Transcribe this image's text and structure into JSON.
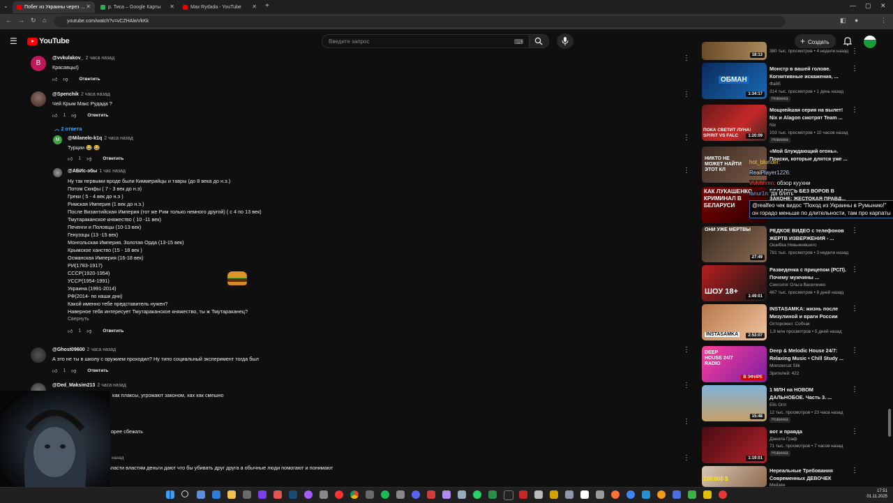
{
  "browser": {
    "tabs": [
      {
        "title": "Побег из Украины через ..."
      },
      {
        "title": "р. Тиса – Google Карты"
      },
      {
        "title": "Max Rydada - YouTube"
      }
    ],
    "url": "youtube.com/watch?v=vCZHAlwVkKk"
  },
  "youtube": {
    "logo": "YouTube",
    "search_placeholder": "Введите запрос",
    "create_label": "Создать"
  },
  "comments": [
    {
      "author": "@vvkulakov_",
      "time": "2 часа назад",
      "text": "Красавцы!)",
      "likes": "",
      "reply": "Ответить",
      "avatar_letter": "В"
    },
    {
      "author": "@Spenchik",
      "time": "2 часа назад",
      "text": "Чей Крым Макс Рудада ?",
      "likes": "1",
      "reply": "Ответить",
      "replies_toggle": "2 ответа"
    },
    {
      "author": "@Milanelo-k1q",
      "time": "2 часа назад",
      "text": "Турции 😂 😂",
      "likes": "1",
      "reply": "Ответить",
      "avatar_letter": "M"
    },
    {
      "author": "@АБИс-эбы",
      "time": "1 час назад",
      "lines": [
        "Ну так первыми вроде были Киммерийцы и тавры (до 8 века до н.э.)",
        "Потом Скифы ( 7 - 3 век до н.э)",
        "Греки ( 5 - 4 век до н.э )",
        "Римская Империя (1 век до н.э.)",
        "После Византийская Империя (тот же Рим только немного другой) ( с 4 по 13 век)",
        "Тмутараканское княжество ( 10 -11 век)",
        "Печенги и Половцы (10-13 век)",
        "Генуэзцы (13 -15 век)",
        "Монгольская Империя, Золотая Орда (13-15 век)",
        "Крымское ханство (15 - 18 век )",
        "Османская Империя (16-18 век)",
        "РИ(1783-1917)",
        "СССР(1920-1954)",
        "УССР(1954-1991)",
        "Украина (1991-2014)",
        "РФ(2014- по наши дни)",
        "Какой именно тебе представитель нужен?",
        "Наверное тебя интересует Тмутараканское княжество, ты ж Тмутараканец?"
      ],
      "collapse": "Свернуть",
      "likes": "1",
      "reply": "Ответить"
    },
    {
      "author": "@Ghost09600",
      "time": "2 часа назад",
      "text": "А это не ты в школу с оружием проходил? Ну типо социальный эксперимент тогда был",
      "likes": "1",
      "reply": "Ответить"
    },
    {
      "author": "@Ded_Maksim213",
      "time": "2 часа назад",
      "text": "как плаксы, угрожают законом, хах как смешно"
    },
    {
      "text": "орее сбежать"
    },
    {
      "time": "назад",
      "text": "власти властям деньги дают что бы убивать друг друга а обычные люди помогают и понимают"
    }
  ],
  "sidebar": [
    {
      "duration": "18:13",
      "meta1": "380 тыс. просмотров • 4 недели назад",
      "thumb_text": ""
    },
    {
      "title": "Монстр в вашей голове. Когнитивные искажения, ...",
      "channel": "Файб",
      "meta": "314 тыс. просмотров • 1 день назад",
      "badge": "Новинка",
      "duration": "1:34:17",
      "thumb_text": "ОБМАН"
    },
    {
      "title": "Мощнейшая серия на вылет! Nix и Alagon смотрят Team ...",
      "channel": "Nix",
      "meta": "103 тыс. просмотров • 10 часов назад",
      "badge": "Новинка",
      "duration": "1:20:09",
      "thumb_text": "ПОКА СВЕТИТ ЛУНА! SPIRIT VS FALC"
    },
    {
      "title": "«Мой блуждающий огонь». Поиски, которые длятся уже ...",
      "channel": "",
      "meta": "",
      "duration": "",
      "thumb_text": "НИКТО НЕ МОЖЕТ НАЙТИ ЭТОТ КЛ"
    },
    {
      "title": "БЕЛАРУСЬ БЕЗ ВОРОВ В ЗАКОНЕ: ЖЕСТОКАЯ ПРАВД...",
      "channel": "",
      "meta": "",
      "duration": "",
      "thumb_text": "КАК ЛУКАШЕНКО КРИМИНАЛ В БЕЛАРУСИ"
    },
    {
      "title": "РЕДКОЕ ВИДЕО с телефонов ЖЕРТВ ИЗВЕРЖЕНИЯ - ...",
      "channel": "Ошибка Невыжившего",
      "meta": "781 тыс. просмотров • 3 недели назад",
      "duration": "27:49",
      "thumb_text": "ОНИ УЖЕ МЕРТВЫ"
    },
    {
      "title": "Разведенка с прицепом (РСП). Почему мужчины ...",
      "channel": "Сексолог Ольга Василенко",
      "meta": "467 тыс. просмотров • 8 дней назад",
      "duration": "1:49:01",
      "thumb_text": "ШОУ 18+"
    },
    {
      "title": "INSTASAMKA: жизнь после Мизулиной и враги России",
      "channel": "Осторожно: Собчак",
      "meta": "1,8 млн просмотров • 5 дней назад",
      "duration": "2:53:07",
      "thumb_text": "INSTASAMKA"
    },
    {
      "title": "Deep & Melodic House 24/7: Relaxing Music • Chill Study ...",
      "channel": "Monstercat Silk",
      "meta": "Зрителей: 422",
      "duration": "",
      "live": "В ЭФИРЕ",
      "thumb_text": "DEEP HOUSE 24/7 RADIO"
    },
    {
      "title": "1 МЛН на НОВОМ ДАЛЬНОБОЕ. Часть 3. ...",
      "channel": "Elis Grin",
      "meta": "12 тыс. просмотров • 23 часа назад",
      "badge": "Новинка",
      "duration": "15:48",
      "thumb_text": ""
    },
    {
      "title": "вот и правда",
      "channel": "Данила Граф",
      "meta": "71 тыс. просмотров • 7 часов назад",
      "badge": "Новинка",
      "duration": "1:19:01",
      "thumb_text": ""
    },
    {
      "title": "Нереальные Требования Современных ДЕВОЧЕК",
      "channel": "Мейзен",
      "meta": "",
      "duration": "",
      "thumb_text": "100.000 $"
    }
  ],
  "chat": [
    {
      "user": "hot_blunder:",
      "text": ""
    },
    {
      "user": "RealPlayer1226:",
      "text": ""
    },
    {
      "user": "vlvlvlmmn:",
      "text": "обзор куухни"
    },
    {
      "user": "lanur1n:",
      "text": "да блять"
    },
    {
      "user": "",
      "text": "@realfeo чек видос \"Поход из Украины в Румынию!\" он горадо меньше по длительности, там про карпаты"
    }
  ],
  "taskbar": {
    "time": "17:51",
    "date": "01.11.2025"
  }
}
